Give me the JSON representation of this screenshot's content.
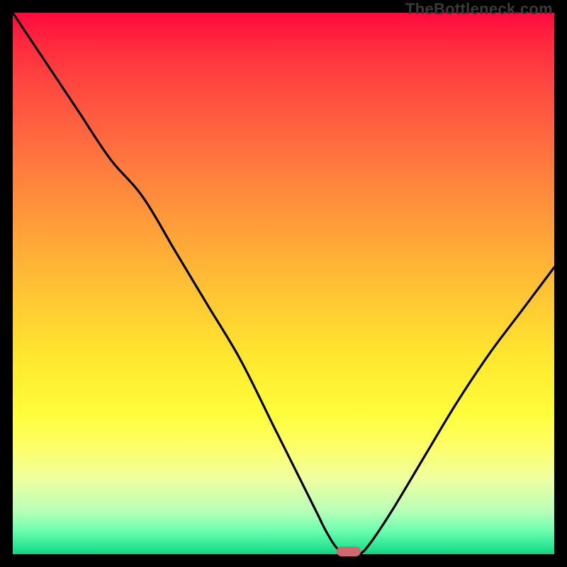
{
  "watermark": "TheBottleneck.com",
  "colors": {
    "frame": "#000000",
    "curve": "#000000",
    "marker": "#cc6a70"
  },
  "chart_data": {
    "type": "line",
    "title": "",
    "xlabel": "",
    "ylabel": "",
    "xlim": [
      0,
      100
    ],
    "ylim": [
      0,
      100
    ],
    "grid": false,
    "legend": false,
    "notes": "Background is a vertical heatmap gradient from red (top, ~100% bottleneck) to green (bottom, ~0%). Curve shows bottleneck % vs an unlabeled x-axis with a minimum near x≈62.",
    "series": [
      {
        "name": "bottleneck-curve",
        "x": [
          0,
          6,
          12,
          18,
          24,
          30,
          36,
          42,
          48,
          52,
          56,
          58,
          60,
          62,
          64,
          66,
          70,
          76,
          82,
          88,
          94,
          100
        ],
        "values": [
          100,
          91,
          82,
          73,
          66,
          56,
          46,
          36,
          24,
          16,
          8,
          4,
          1,
          0,
          0,
          2,
          8,
          18,
          28,
          37,
          45,
          53
        ]
      }
    ],
    "marker": {
      "x": 62,
      "y": 0
    },
    "gradient_stops": [
      {
        "pct": 0,
        "color": "#ff0a3e"
      },
      {
        "pct": 25,
        "color": "#ff6f3f"
      },
      {
        "pct": 52,
        "color": "#ffc534"
      },
      {
        "pct": 74,
        "color": "#fffd3b"
      },
      {
        "pct": 92,
        "color": "#b8ffb8"
      },
      {
        "pct": 100,
        "color": "#1fc97e"
      }
    ]
  }
}
